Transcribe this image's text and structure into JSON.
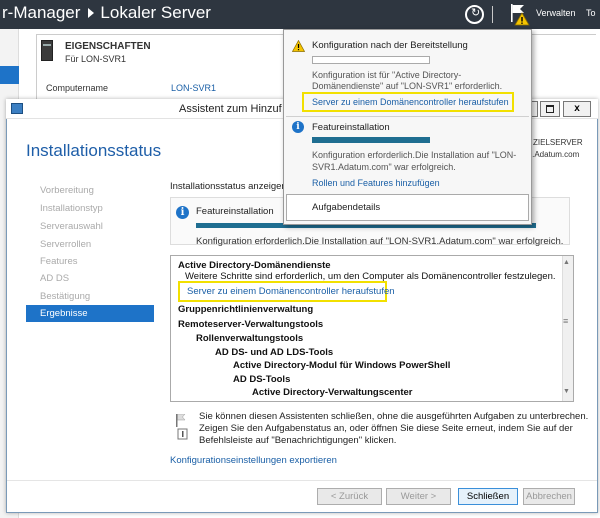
{
  "server_manager": {
    "title_left": "r-Manager",
    "title_right": "Lokaler Server",
    "menu_manage": "Verwalten",
    "menu_tools": "To",
    "properties_heading": "EIGENSCHAFTEN",
    "properties_sub": "Für LON-SVR1",
    "computer_name_label": "Computername",
    "computer_name_value": "LON-SVR1"
  },
  "wizard": {
    "title": "Assistent zum Hinzuf",
    "close_symbol": "x",
    "heading": "Installationsstatus",
    "target_line1": "ZIELSERVER",
    "target_line2": "r1.Adatum.com",
    "steps": [
      "Vorbereitung",
      "Installationstyp",
      "Serverauswahl",
      "Serverrollen",
      "Features",
      "AD DS",
      "Bestätigung",
      "Ergebnisse"
    ],
    "status_label": "Installationsstatus anzeigen",
    "feature_title": "Featureinstallation",
    "feature_desc": "Konfiguration erforderlich.Die Installation auf \"LON-SVR1.Adatum.com\" war erfolgreich.",
    "results": {
      "ad_ds_title": "Active Directory-Domänendienste",
      "ad_ds_desc": "Weitere Schritte sind erforderlich, um den Computer als Domänencontroller festzulegen.",
      "promote_link": "Server zu einem Domänencontroller heraufstufen",
      "gpm": "Gruppenrichtlinienverwaltung",
      "rsat": "Remoteserver-Verwaltungstools",
      "role_tools": "Rollenverwaltungstools",
      "adds_lds": "AD DS- und AD LDS-Tools",
      "ps_module": "Active Directory-Modul für Windows PowerShell",
      "adds_tools": "AD DS-Tools",
      "ad_admin_center": "Active Directory-Verwaltungscenter"
    },
    "close_info_1": "Sie können diesen Assistenten schließen, ohne die ausgeführten Aufgaben zu unterbrechen.",
    "close_info_2": "Zeigen Sie den Aufgabenstatus an, oder öffnen Sie diese Seite erneut, indem Sie auf der",
    "close_info_3": "Befehlsleiste auf \"Benachrichtigungen\" klicken.",
    "export_link": "Konfigurationseinstellungen exportieren",
    "buttons": {
      "back": "< Zurück",
      "next": "Weiter >",
      "close": "Schließen",
      "cancel": "Abbrechen"
    }
  },
  "notifications": {
    "n1_title": "Konfiguration nach der Bereitstellung",
    "n1_desc_1": "Konfiguration ist für \"Active Directory-",
    "n1_desc_2": "Domänendienste\" auf \"LON-SVR1\" erforderlich.",
    "n1_link": "Server zu einem Domänencontroller heraufstufen",
    "n2_title": "Featureinstallation",
    "n2_desc_1": "Konfiguration erforderlich.Die Installation auf \"LON-",
    "n2_desc_2": "SVR1.Adatum.com\" war erfolgreich.",
    "n2_link": "Rollen und Features hinzufügen",
    "task_details": "Aufgabendetails"
  },
  "colors": {
    "titlebar": "#2e3640",
    "accent_blue": "#1e73c8",
    "link_blue": "#1a5fa6",
    "progress": "#1f6e91",
    "highlight_yellow": "#f2e000"
  },
  "progress": {
    "feature_installation": 1.0,
    "post_deployment_config": 0.0
  }
}
